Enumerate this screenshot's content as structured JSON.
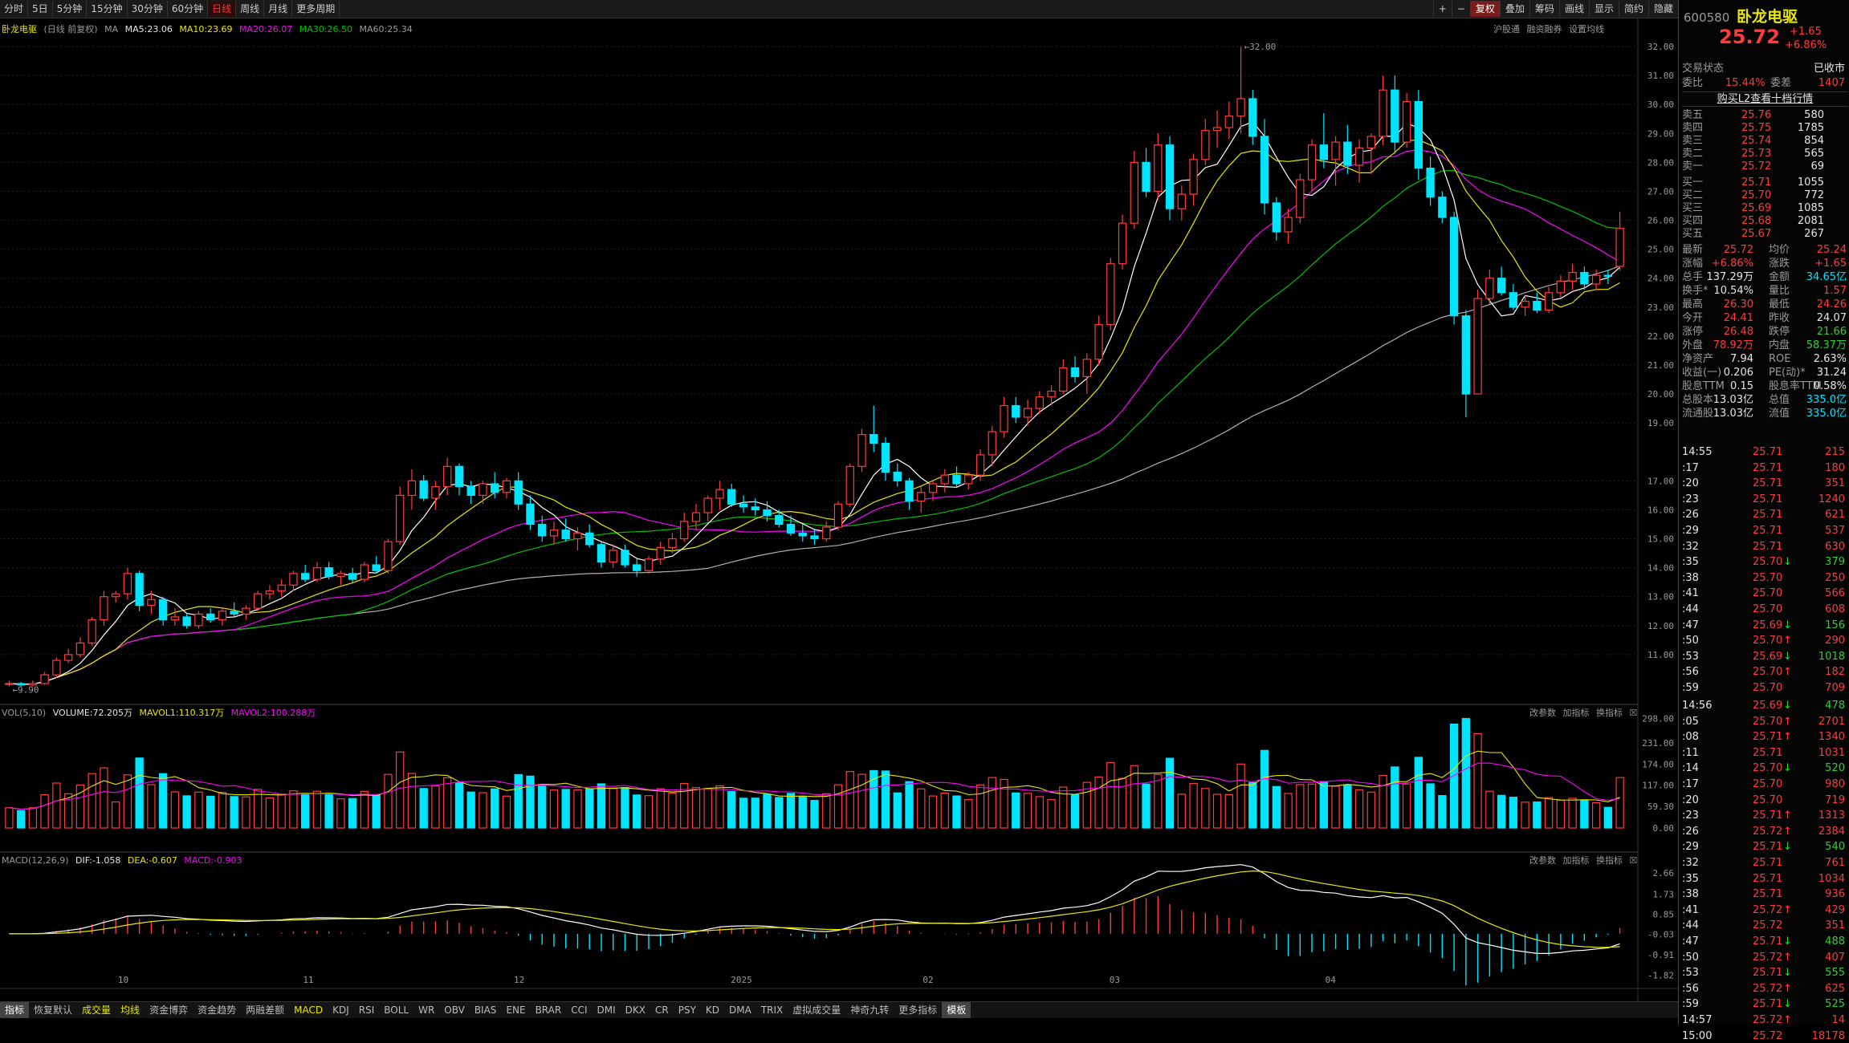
{
  "toolbar": {
    "periods": [
      "分时",
      "5日",
      "5分钟",
      "15分钟",
      "30分钟",
      "60分钟",
      "日线",
      "周线",
      "月线",
      "更多周期"
    ],
    "active_period": "日线",
    "right_buttons": [
      "+",
      "−",
      "复权",
      "叠加",
      "筹码",
      "画线",
      "显示",
      "简约",
      "隐藏"
    ],
    "active_right": "复权"
  },
  "chart_header": {
    "stock_name": "卧龙电驱",
    "mode": "(日线 前复权)",
    "ma_label": "MA",
    "ma5": "MA5:23.06",
    "ma10": "MA10:23.69",
    "ma20": "MA20:26.07",
    "ma30": "MA30:26.50",
    "ma60": "MA60:25.34",
    "links": [
      "沪股通",
      "融资融券",
      "设置均线"
    ]
  },
  "price_annotations": {
    "high": "32.00",
    "low": "9.90"
  },
  "price_axis": [
    "32.00",
    "31.00",
    "30.00",
    "29.00",
    "28.00",
    "27.00",
    "26.00",
    "25.00",
    "24.00",
    "23.00",
    "22.00",
    "21.00",
    "20.00",
    "19.00",
    "17.00",
    "16.00",
    "15.00",
    "14.00",
    "13.00",
    "12.00",
    "11.00"
  ],
  "volume_header": {
    "name": "VOL(5,10)",
    "volume": "VOLUME:72.205万",
    "mavol1": "MAVOL1:110.317万",
    "mavol2": "MAVOL2:100.288万",
    "buttons": [
      "改参数",
      "加指标",
      "换指标"
    ]
  },
  "volume_axis": [
    "298.00",
    "231.00",
    "174.00",
    "117.00",
    "59.30",
    "0.00"
  ],
  "macd_header": {
    "name": "MACD(12,26,9)",
    "dif": "DIF:-1.058",
    "dea": "DEA:-0.607",
    "macd": "MACD:-0.903",
    "buttons": [
      "改参数",
      "加指标",
      "换指标"
    ]
  },
  "macd_axis": [
    "2.66",
    "1.73",
    "0.85",
    "-0.03",
    "-0.91",
    "-1.82"
  ],
  "x_axis": [
    "10",
    "11",
    "12",
    "2025",
    "02",
    "03",
    "04"
  ],
  "bottom_tabs": [
    "指标",
    "恢复默认",
    "成交量",
    "均线",
    "资金博弈",
    "资金趋势",
    "两融差额",
    "MACD",
    "KDJ",
    "RSI",
    "BOLL",
    "WR",
    "OBV",
    "BIAS",
    "ENE",
    "BRAR",
    "CCI",
    "DMI",
    "DKX",
    "CR",
    "PSY",
    "KD",
    "DMA",
    "TRIX",
    "虚拟成交量",
    "神奇九转",
    "更多指标",
    "模板"
  ],
  "quote": {
    "code": "600580",
    "name": "卧龙电驱",
    "price": "25.72",
    "change": "+1.65",
    "change_pct": "+6.86%",
    "status_label": "交易状态",
    "status": "已收市",
    "weibi_label": "委比",
    "weibi": "15.44%",
    "weicha_label": "委差",
    "weicha": "1407",
    "l2_link": "购买L2查看十档行情",
    "asks": [
      {
        "label": "卖五",
        "price": "25.76",
        "vol": "580"
      },
      {
        "label": "卖四",
        "price": "25.75",
        "vol": "1785"
      },
      {
        "label": "卖三",
        "price": "25.74",
        "vol": "854"
      },
      {
        "label": "卖二",
        "price": "25.73",
        "vol": "565"
      },
      {
        "label": "卖一",
        "price": "25.72",
        "vol": "69"
      }
    ],
    "bids": [
      {
        "label": "买一",
        "price": "25.71",
        "vol": "1055"
      },
      {
        "label": "买二",
        "price": "25.70",
        "vol": "772"
      },
      {
        "label": "买三",
        "price": "25.69",
        "vol": "1085"
      },
      {
        "label": "买四",
        "price": "25.68",
        "vol": "2081"
      },
      {
        "label": "买五",
        "price": "25.67",
        "vol": "267"
      }
    ],
    "stats": [
      [
        "最新",
        "25.72",
        "均价",
        "25.24"
      ],
      [
        "涨幅",
        "+6.86%",
        "涨跌",
        "+1.65"
      ],
      [
        "总手",
        "137.29万",
        "金额",
        "34.65亿"
      ],
      [
        "换手*",
        "10.54%",
        "量比",
        "1.57"
      ],
      [
        "最高",
        "26.30",
        "最低",
        "24.26"
      ],
      [
        "今开",
        "24.41",
        "昨收",
        "24.07"
      ],
      [
        "涨停",
        "26.48",
        "跌停",
        "21.66"
      ],
      [
        "外盘",
        "78.92万",
        "内盘",
        "58.37万"
      ],
      [
        "净资产",
        "7.94",
        "ROE",
        "2.63%"
      ],
      [
        "收益(一)",
        "0.206",
        "PE(动)*",
        "31.24"
      ],
      [
        "股息TTM",
        "0.15",
        "股息率TTM",
        "0.58%"
      ],
      [
        "总股本",
        "13.03亿",
        "总值",
        "335.0亿"
      ],
      [
        "流通股",
        "13.03亿",
        "流值",
        "335.0亿"
      ]
    ]
  },
  "ticks": [
    {
      "t": "14:55",
      "p": "25.71",
      "v": "215",
      "d": ""
    },
    {
      "t": ":17",
      "p": "25.71",
      "v": "180",
      "d": ""
    },
    {
      "t": ":20",
      "p": "25.71",
      "v": "351",
      "d": ""
    },
    {
      "t": ":23",
      "p": "25.71",
      "v": "1240",
      "d": ""
    },
    {
      "t": ":26",
      "p": "25.71",
      "v": "621",
      "d": ""
    },
    {
      "t": ":29",
      "p": "25.71",
      "v": "537",
      "d": ""
    },
    {
      "t": ":32",
      "p": "25.71",
      "v": "630",
      "d": ""
    },
    {
      "t": ":35",
      "p": "25.70",
      "v": "379",
      "d": "down"
    },
    {
      "t": ":38",
      "p": "25.70",
      "v": "250",
      "d": ""
    },
    {
      "t": ":41",
      "p": "25.70",
      "v": "566",
      "d": ""
    },
    {
      "t": ":44",
      "p": "25.70",
      "v": "608",
      "d": ""
    },
    {
      "t": ":47",
      "p": "25.69",
      "v": "156",
      "d": "down"
    },
    {
      "t": ":50",
      "p": "25.70",
      "v": "290",
      "d": "up"
    },
    {
      "t": ":53",
      "p": "25.69",
      "v": "1018",
      "d": "down"
    },
    {
      "t": ":56",
      "p": "25.70",
      "v": "182",
      "d": "up"
    },
    {
      "t": ":59",
      "p": "25.70",
      "v": "709",
      "d": ""
    },
    {
      "t": "14:56",
      "p": "25.69",
      "v": "478",
      "d": "down"
    },
    {
      "t": ":05",
      "p": "25.70",
      "v": "2701",
      "d": "up"
    },
    {
      "t": ":08",
      "p": "25.71",
      "v": "1340",
      "d": "up"
    },
    {
      "t": ":11",
      "p": "25.71",
      "v": "1031",
      "d": ""
    },
    {
      "t": ":14",
      "p": "25.70",
      "v": "520",
      "d": "down"
    },
    {
      "t": ":17",
      "p": "25.70",
      "v": "980",
      "d": ""
    },
    {
      "t": ":20",
      "p": "25.70",
      "v": "719",
      "d": ""
    },
    {
      "t": ":23",
      "p": "25.71",
      "v": "1313",
      "d": "up"
    },
    {
      "t": ":26",
      "p": "25.72",
      "v": "2384",
      "d": "up"
    },
    {
      "t": ":29",
      "p": "25.71",
      "v": "540",
      "d": "down"
    },
    {
      "t": ":32",
      "p": "25.71",
      "v": "761",
      "d": ""
    },
    {
      "t": ":35",
      "p": "25.71",
      "v": "1034",
      "d": ""
    },
    {
      "t": ":38",
      "p": "25.71",
      "v": "936",
      "d": ""
    },
    {
      "t": ":41",
      "p": "25.72",
      "v": "429",
      "d": "up"
    },
    {
      "t": ":44",
      "p": "25.72",
      "v": "351",
      "d": ""
    },
    {
      "t": ":47",
      "p": "25.71",
      "v": "488",
      "d": "down"
    },
    {
      "t": ":50",
      "p": "25.72",
      "v": "407",
      "d": "up"
    },
    {
      "t": ":53",
      "p": "25.71",
      "v": "555",
      "d": "down"
    },
    {
      "t": ":56",
      "p": "25.72",
      "v": "625",
      "d": "up"
    },
    {
      "t": ":59",
      "p": "25.71",
      "v": "525",
      "d": "down"
    },
    {
      "t": "14:57",
      "p": "25.72",
      "v": "14",
      "d": "up"
    },
    {
      "t": "15:00",
      "p": "25.72",
      "v": "18178",
      "d": ""
    }
  ],
  "chart_data": {
    "type": "candlestick",
    "title": "卧龙电驱 日线 前复权",
    "candles_ohlc": [
      [
        10.0,
        10.1,
        9.9,
        10.0
      ],
      [
        10.0,
        10.05,
        9.9,
        9.95
      ],
      [
        9.95,
        10.1,
        9.9,
        10.0
      ],
      [
        10.0,
        10.4,
        9.95,
        10.3
      ],
      [
        10.3,
        10.9,
        10.2,
        10.8
      ],
      [
        10.8,
        11.2,
        10.7,
        11.0
      ],
      [
        11.0,
        11.6,
        10.9,
        11.4
      ],
      [
        11.4,
        12.3,
        11.3,
        12.2
      ],
      [
        12.2,
        13.2,
        12.0,
        13.0
      ],
      [
        13.0,
        13.2,
        12.8,
        13.1
      ],
      [
        13.1,
        14.0,
        12.9,
        13.8
      ],
      [
        13.8,
        13.9,
        12.5,
        12.7
      ],
      [
        12.7,
        13.2,
        12.4,
        12.9
      ],
      [
        12.9,
        13.0,
        12.0,
        12.2
      ],
      [
        12.2,
        12.6,
        12.0,
        12.3
      ],
      [
        12.3,
        12.4,
        11.9,
        12.0
      ],
      [
        12.0,
        12.5,
        11.9,
        12.4
      ],
      [
        12.4,
        12.6,
        12.1,
        12.2
      ],
      [
        12.2,
        12.6,
        12.0,
        12.5
      ],
      [
        12.5,
        12.8,
        12.3,
        12.4
      ],
      [
        12.4,
        12.7,
        12.2,
        12.6
      ],
      [
        12.6,
        13.2,
        12.5,
        13.1
      ],
      [
        13.1,
        13.4,
        12.9,
        13.2
      ],
      [
        13.2,
        13.6,
        13.0,
        13.4
      ],
      [
        13.4,
        13.9,
        13.2,
        13.8
      ],
      [
        13.8,
        14.1,
        13.5,
        13.6
      ],
      [
        13.6,
        14.2,
        13.5,
        14.0
      ],
      [
        14.0,
        14.2,
        13.6,
        13.7
      ],
      [
        13.7,
        13.9,
        13.4,
        13.8
      ],
      [
        13.8,
        14.0,
        13.5,
        13.6
      ],
      [
        13.6,
        14.2,
        13.5,
        14.1
      ],
      [
        14.1,
        14.4,
        13.8,
        13.9
      ],
      [
        13.9,
        15.0,
        13.8,
        14.9
      ],
      [
        14.9,
        16.8,
        14.8,
        16.5
      ],
      [
        16.5,
        17.4,
        16.0,
        17.0
      ],
      [
        17.0,
        17.2,
        16.3,
        16.4
      ],
      [
        16.4,
        17.0,
        16.0,
        16.8
      ],
      [
        16.8,
        17.8,
        16.5,
        17.5
      ],
      [
        17.5,
        17.6,
        16.5,
        16.8
      ],
      [
        16.8,
        17.0,
        16.2,
        16.5
      ],
      [
        16.5,
        17.0,
        16.2,
        16.9
      ],
      [
        16.9,
        17.3,
        16.4,
        16.6
      ],
      [
        16.6,
        17.1,
        16.4,
        17.0
      ],
      [
        17.0,
        17.3,
        16.0,
        16.2
      ],
      [
        16.2,
        16.5,
        15.3,
        15.5
      ],
      [
        15.5,
        15.8,
        14.9,
        15.1
      ],
      [
        15.1,
        15.6,
        14.8,
        15.3
      ],
      [
        15.3,
        15.7,
        14.9,
        15.0
      ],
      [
        15.0,
        15.4,
        14.6,
        15.2
      ],
      [
        15.2,
        15.5,
        14.7,
        14.8
      ],
      [
        14.8,
        14.9,
        14.0,
        14.2
      ],
      [
        14.2,
        14.8,
        14.0,
        14.6
      ],
      [
        14.6,
        14.8,
        14.0,
        14.1
      ],
      [
        14.1,
        14.3,
        13.7,
        13.9
      ],
      [
        13.9,
        14.4,
        13.8,
        14.3
      ],
      [
        14.3,
        14.9,
        14.1,
        14.7
      ],
      [
        14.7,
        15.2,
        14.5,
        15.0
      ],
      [
        15.0,
        15.9,
        14.9,
        15.6
      ],
      [
        15.6,
        16.2,
        15.3,
        15.9
      ],
      [
        15.9,
        16.5,
        15.6,
        16.4
      ],
      [
        16.4,
        17.0,
        16.0,
        16.7
      ],
      [
        16.7,
        16.9,
        16.1,
        16.2
      ],
      [
        16.2,
        16.5,
        15.9,
        16.1
      ],
      [
        16.1,
        16.4,
        15.8,
        16.0
      ],
      [
        16.0,
        16.3,
        15.6,
        15.8
      ],
      [
        15.8,
        16.0,
        15.4,
        15.5
      ],
      [
        15.5,
        15.8,
        15.1,
        15.2
      ],
      [
        15.2,
        15.5,
        14.9,
        15.1
      ],
      [
        15.1,
        15.3,
        14.8,
        15.0
      ],
      [
        15.0,
        15.6,
        14.9,
        15.4
      ],
      [
        15.4,
        16.3,
        15.3,
        16.2
      ],
      [
        16.2,
        17.6,
        16.1,
        17.5
      ],
      [
        17.5,
        18.8,
        17.3,
        18.6
      ],
      [
        18.6,
        19.6,
        18.0,
        18.3
      ],
      [
        18.3,
        18.5,
        17.0,
        17.3
      ],
      [
        17.3,
        17.6,
        16.8,
        17.0
      ],
      [
        17.0,
        17.1,
        16.0,
        16.3
      ],
      [
        16.3,
        16.8,
        15.9,
        16.6
      ],
      [
        16.6,
        17.0,
        16.3,
        16.9
      ],
      [
        16.9,
        17.4,
        16.6,
        17.2
      ],
      [
        17.2,
        17.5,
        16.8,
        16.9
      ],
      [
        16.9,
        17.3,
        16.7,
        17.2
      ],
      [
        17.2,
        18.1,
        17.0,
        17.9
      ],
      [
        17.9,
        18.9,
        17.5,
        18.7
      ],
      [
        18.7,
        19.9,
        18.5,
        19.6
      ],
      [
        19.6,
        19.9,
        19.0,
        19.2
      ],
      [
        19.2,
        19.8,
        18.9,
        19.5
      ],
      [
        19.5,
        20.1,
        19.3,
        19.9
      ],
      [
        19.9,
        20.3,
        19.6,
        20.1
      ],
      [
        20.1,
        21.2,
        20.0,
        20.9
      ],
      [
        20.9,
        21.3,
        20.4,
        20.6
      ],
      [
        20.6,
        21.4,
        20.0,
        21.2
      ],
      [
        21.2,
        22.7,
        21.0,
        22.4
      ],
      [
        22.4,
        24.7,
        22.2,
        24.5
      ],
      [
        24.5,
        26.2,
        24.3,
        25.9
      ],
      [
        25.9,
        28.4,
        25.7,
        28.0
      ],
      [
        28.0,
        28.5,
        26.8,
        27.0
      ],
      [
        27.0,
        29.0,
        26.7,
        28.6
      ],
      [
        28.6,
        28.9,
        26.0,
        26.4
      ],
      [
        26.4,
        27.2,
        26.0,
        26.9
      ],
      [
        26.9,
        28.3,
        26.5,
        28.1
      ],
      [
        28.1,
        29.5,
        27.9,
        29.1
      ],
      [
        29.1,
        29.8,
        28.5,
        29.2
      ],
      [
        29.2,
        30.1,
        28.8,
        29.6
      ],
      [
        29.6,
        32.0,
        29.0,
        30.2
      ],
      [
        30.2,
        30.5,
        28.6,
        28.9
      ],
      [
        28.9,
        29.5,
        26.2,
        26.6
      ],
      [
        26.6,
        26.8,
        25.3,
        25.6
      ],
      [
        25.6,
        26.4,
        25.2,
        26.1
      ],
      [
        26.1,
        27.6,
        25.9,
        27.4
      ],
      [
        27.4,
        28.8,
        27.0,
        28.6
      ],
      [
        28.6,
        29.7,
        27.8,
        28.1
      ],
      [
        28.1,
        28.9,
        27.2,
        28.7
      ],
      [
        28.7,
        29.3,
        27.6,
        27.9
      ],
      [
        27.9,
        28.8,
        27.3,
        28.5
      ],
      [
        28.5,
        29.0,
        27.6,
        28.9
      ],
      [
        28.9,
        31.0,
        28.6,
        30.5
      ],
      [
        30.5,
        31.0,
        28.3,
        28.7
      ],
      [
        28.7,
        30.4,
        28.5,
        30.1
      ],
      [
        30.1,
        30.5,
        27.4,
        27.8
      ],
      [
        27.8,
        28.2,
        26.5,
        26.8
      ],
      [
        26.8,
        27.0,
        25.9,
        26.1
      ],
      [
        26.1,
        26.3,
        22.4,
        22.7
      ],
      [
        22.7,
        22.9,
        19.2,
        20.0
      ],
      [
        20.0,
        23.6,
        20.0,
        23.3
      ],
      [
        23.3,
        24.3,
        23.1,
        24.0
      ],
      [
        24.0,
        24.4,
        23.4,
        23.5
      ],
      [
        23.5,
        23.8,
        22.9,
        23.0
      ],
      [
        23.0,
        23.4,
        22.7,
        23.2
      ],
      [
        23.2,
        23.5,
        22.8,
        22.9
      ],
      [
        22.9,
        23.7,
        22.8,
        23.5
      ],
      [
        23.5,
        24.1,
        23.3,
        23.9
      ],
      [
        23.9,
        24.5,
        23.6,
        24.2
      ],
      [
        24.2,
        24.4,
        23.6,
        23.8
      ],
      [
        23.8,
        24.3,
        23.6,
        24.1
      ],
      [
        24.1,
        24.3,
        23.8,
        24.07
      ],
      [
        24.41,
        26.3,
        24.26,
        25.72
      ]
    ],
    "x_ticks": [
      "10",
      "11",
      "12",
      "2025",
      "02",
      "03",
      "04"
    ],
    "y_range": [
      9.5,
      32.5
    ],
    "ma_latest": {
      "MA5": 23.06,
      "MA10": 23.69,
      "MA20": 26.07,
      "MA30": 26.5,
      "MA60": 25.34
    },
    "volume_latest_wan": 72.205,
    "macd_latest": {
      "DIF": -1.058,
      "DEA": -0.607,
      "MACD": -0.903
    }
  },
  "colors": {
    "up": "#ff3b3b",
    "down": "#00e5ff",
    "ma5": "#ffffff",
    "ma10": "#e8e800",
    "ma20": "#ff00ff",
    "ma30": "#00c000",
    "ma60": "#b0b0b0"
  }
}
